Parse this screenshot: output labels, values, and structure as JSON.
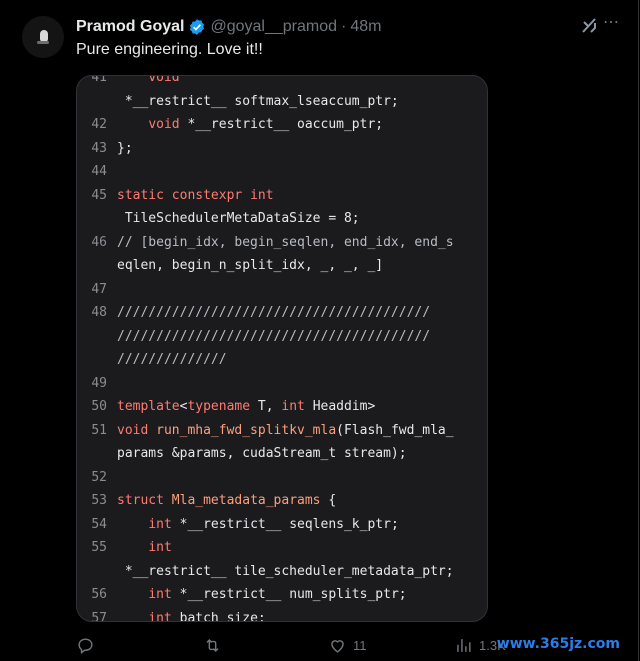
{
  "tweet": {
    "author_name": "Pramod Goyal",
    "handle": "@goyal__pramod",
    "separator": "·",
    "time": "48m",
    "text": "Pure engineering. Love it!!"
  },
  "code": {
    "lines": [
      {
        "n": "41",
        "t": "    void"
      },
      {
        "n": "",
        "t": " *__restrict__ softmax_lseaccum_ptr;"
      },
      {
        "n": "42",
        "t": "    void *__restrict__ oaccum_ptr;"
      },
      {
        "n": "43",
        "t": "};"
      },
      {
        "n": "44",
        "t": ""
      },
      {
        "n": "45",
        "t": "static constexpr int"
      },
      {
        "n": "",
        "t": " TileSchedulerMetaDataSize = 8;"
      },
      {
        "n": "46",
        "t": "// [begin_idx, begin_seqlen, end_idx, end_s"
      },
      {
        "n": "",
        "t": "eqlen, begin_n_split_idx, _, _, _]"
      },
      {
        "n": "47",
        "t": ""
      },
      {
        "n": "48",
        "t": "////////////////////////////////////////"
      },
      {
        "n": "",
        "t": "////////////////////////////////////////"
      },
      {
        "n": "",
        "t": "//////////////"
      },
      {
        "n": "49",
        "t": ""
      },
      {
        "n": "50",
        "t": "template<typename T, int Headdim>"
      },
      {
        "n": "51",
        "t": "void run_mha_fwd_splitkv_mla(Flash_fwd_mla_"
      },
      {
        "n": "",
        "t": "params &params, cudaStream_t stream);"
      },
      {
        "n": "52",
        "t": ""
      },
      {
        "n": "53",
        "t": "struct Mla_metadata_params {"
      },
      {
        "n": "54",
        "t": "    int *__restrict__ seqlens_k_ptr;"
      },
      {
        "n": "55",
        "t": "    int"
      },
      {
        "n": "",
        "t": " *__restrict__ tile_scheduler_metadata_ptr;"
      },
      {
        "n": "56",
        "t": "    int *__restrict__ num_splits_ptr;"
      },
      {
        "n": "57",
        "t": "    int batch_size;"
      }
    ]
  },
  "actions": {
    "likes": "11",
    "views": "1.3K"
  },
  "watermark": "www.365jz.com",
  "colors": {
    "keyword": "#ff7b72",
    "function": "#ff9e7a",
    "verified": "#1d9bf0"
  },
  "icons": [
    "avatar",
    "verified-badge-icon",
    "grok-icon",
    "more-icon",
    "reply-icon",
    "retweet-icon",
    "like-icon",
    "views-icon"
  ]
}
